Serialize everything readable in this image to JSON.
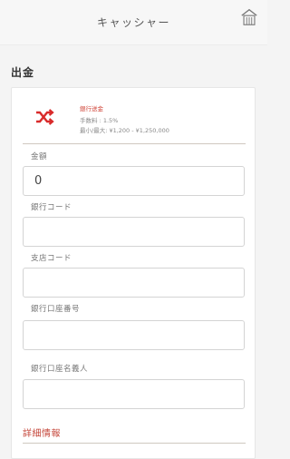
{
  "header": {
    "title": "キャッシャー",
    "home_icon": "home-icon"
  },
  "section": {
    "title": "出金"
  },
  "method": {
    "name": "銀行送金",
    "fee": "手数料 : 1.5%",
    "limits": "最小/最大: ¥1,200 - ¥1,250,000",
    "icon": "shuffle-icon",
    "accent": "#d92b2b"
  },
  "fields": [
    {
      "label": "金額",
      "value": "0",
      "placeholder": ""
    },
    {
      "label": "銀行コード",
      "value": "",
      "placeholder": ""
    },
    {
      "label": "支店コード",
      "value": "",
      "placeholder": ""
    },
    {
      "label": "銀行口座番号",
      "value": "",
      "placeholder": ""
    },
    {
      "label": "銀行口座名義人",
      "value": "",
      "placeholder": ""
    }
  ],
  "details_link": "詳細情報"
}
